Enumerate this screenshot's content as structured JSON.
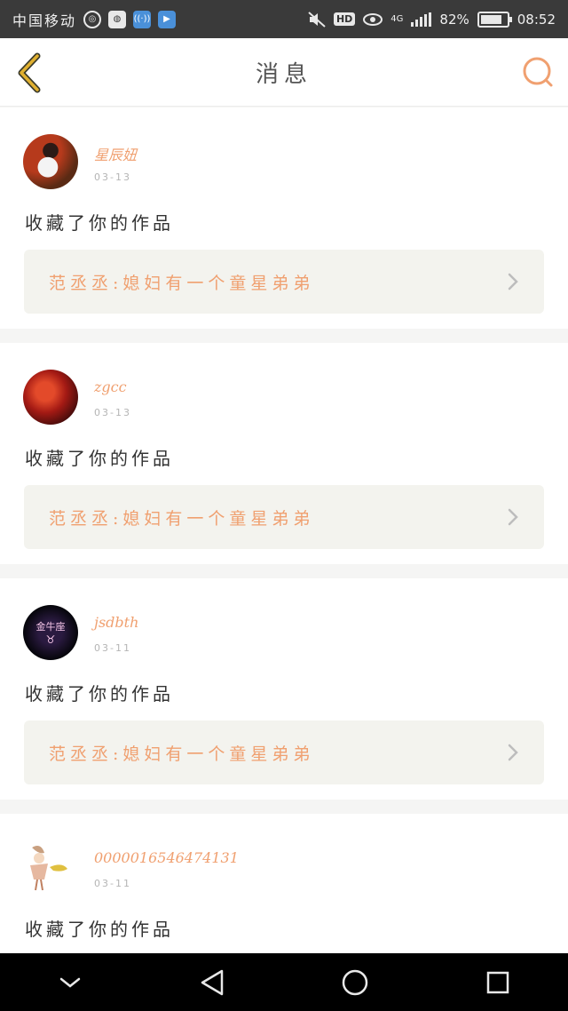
{
  "status_bar": {
    "carrier": "中国移动",
    "hd": "HD",
    "network": "4G",
    "battery": "82%",
    "battery_level": 0.82,
    "time": "08:52"
  },
  "header": {
    "title": "消息"
  },
  "messages": [
    {
      "username": "星辰妞",
      "date": "03-13",
      "action": "收藏了你的作品",
      "work_title": "范丞丞:媳妇有一个童星弟弟"
    },
    {
      "username": "zgcc",
      "date": "03-13",
      "action": "收藏了你的作品",
      "work_title": "范丞丞:媳妇有一个童星弟弟"
    },
    {
      "username": "jsdbth",
      "date": "03-11",
      "action": "收藏了你的作品",
      "work_title": "范丞丞:媳妇有一个童星弟弟",
      "avatar_text": "金牛座"
    },
    {
      "username": "0000016546474131",
      "date": "03-11",
      "action": "收藏了你的作品"
    }
  ],
  "colors": {
    "accent": "#f0a070",
    "back_arrow": "#e0b030",
    "search": "#f0a070",
    "card_box": "#f3f3ee"
  }
}
